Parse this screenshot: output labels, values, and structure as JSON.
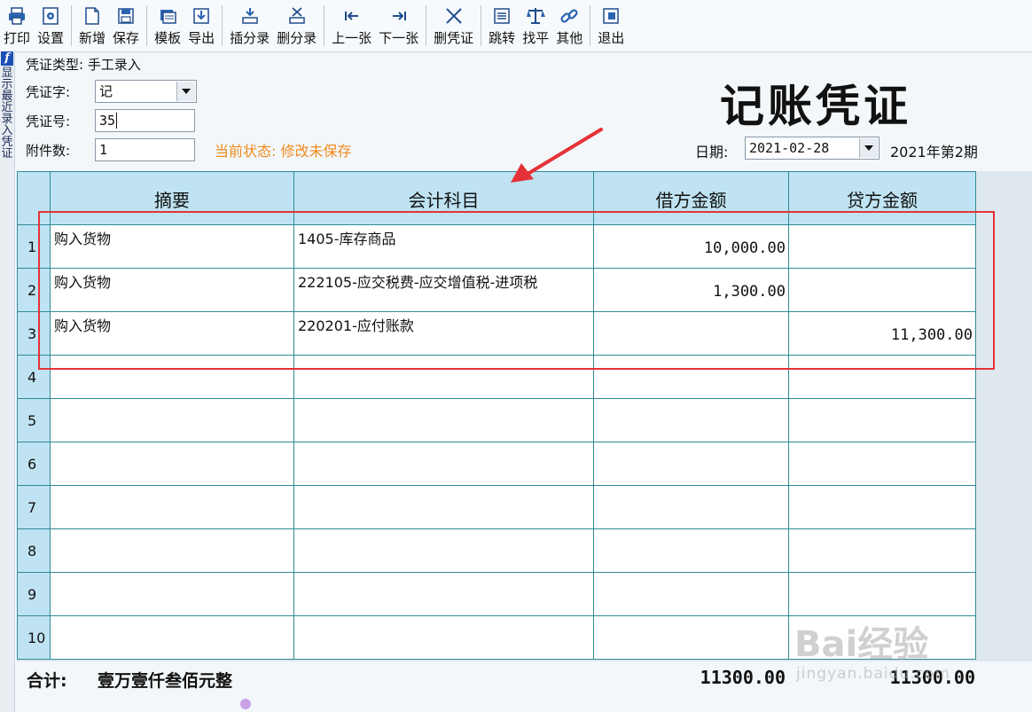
{
  "toolbar": {
    "groups": [
      [
        {
          "label": "打印",
          "icon": "printer-icon"
        },
        {
          "label": "设置",
          "icon": "settings-icon"
        }
      ],
      [
        {
          "label": "新增",
          "icon": "new-doc-icon"
        },
        {
          "label": "保存",
          "icon": "save-icon"
        }
      ],
      [
        {
          "label": "模板",
          "icon": "template-icon"
        },
        {
          "label": "导出",
          "icon": "export-icon"
        }
      ],
      [
        {
          "label": "插分录",
          "icon": "insert-row-icon"
        },
        {
          "label": "删分录",
          "icon": "delete-row-icon"
        }
      ],
      [
        {
          "label": "上一张",
          "icon": "prev-icon"
        },
        {
          "label": "下一张",
          "icon": "next-icon"
        }
      ],
      [
        {
          "label": "删凭证",
          "icon": "delete-voucher-icon"
        }
      ],
      [
        {
          "label": "跳转",
          "icon": "jump-icon"
        },
        {
          "label": "找平",
          "icon": "balance-icon"
        },
        {
          "label": "其他",
          "icon": "link-icon"
        }
      ],
      [
        {
          "label": "退出",
          "icon": "exit-icon"
        }
      ]
    ]
  },
  "sidebar": {
    "logo": "f",
    "text": "显示最近录入凭证"
  },
  "header": {
    "voucher_type_label": "凭证类型:",
    "voucher_type_value": "手工录入",
    "voucher_word_label": "凭证字:",
    "voucher_word_value": "记",
    "voucher_no_label": "凭证号:",
    "voucher_no_value": "35",
    "attachments_label": "附件数:",
    "attachments_value": "1",
    "status_text": "当前状态: 修改未保存",
    "title": "记账凭证",
    "date_label": "日期:",
    "date_value": "2021-02-28",
    "period_text": "2021年第2期"
  },
  "table": {
    "columns": [
      "摘要",
      "会计科目",
      "借方金额",
      "贷方金额"
    ],
    "rows": [
      {
        "no": "1",
        "summary": "购入货物",
        "account": "1405-库存商品",
        "debit": "10,000.00",
        "credit": ""
      },
      {
        "no": "2",
        "summary": "购入货物",
        "account": "222105-应交税费-应交增值税-进项税",
        "debit": "1,300.00",
        "credit": ""
      },
      {
        "no": "3",
        "summary": "购入货物",
        "account": "220201-应付账款",
        "debit": "",
        "credit": "11,300.00"
      },
      {
        "no": "4",
        "summary": "",
        "account": "",
        "debit": "",
        "credit": ""
      },
      {
        "no": "5",
        "summary": "",
        "account": "",
        "debit": "",
        "credit": ""
      },
      {
        "no": "6",
        "summary": "",
        "account": "",
        "debit": "",
        "credit": ""
      },
      {
        "no": "7",
        "summary": "",
        "account": "",
        "debit": "",
        "credit": ""
      },
      {
        "no": "8",
        "summary": "",
        "account": "",
        "debit": "",
        "credit": ""
      },
      {
        "no": "9",
        "summary": "",
        "account": "",
        "debit": "",
        "credit": ""
      },
      {
        "no": "10",
        "summary": "",
        "account": "",
        "debit": "",
        "credit": ""
      }
    ]
  },
  "totals": {
    "label": "合计:",
    "in_words": "壹万壹仟叁佰元整",
    "debit": "11300.00",
    "credit": "11300.00"
  },
  "watermark": {
    "main": "Bai经验",
    "sub": "jingyan.baidu.com"
  },
  "colors": {
    "status": "#f08a1c",
    "grid": "#2f8a97",
    "header_bg": "#bfe3f2",
    "annotation": "#e53238"
  }
}
